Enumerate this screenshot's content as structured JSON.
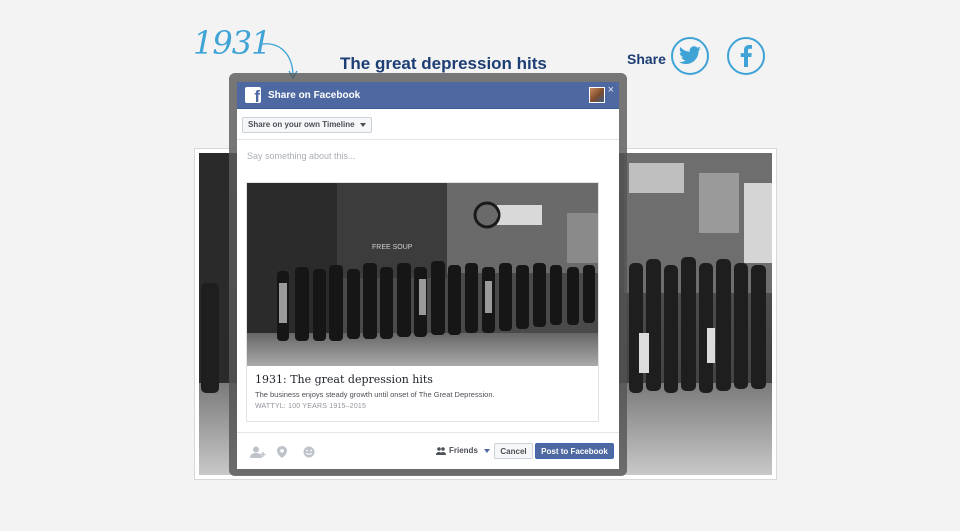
{
  "header": {
    "year": "1931",
    "title": "The great depression hits",
    "share_label": "Share"
  },
  "social": {
    "twitter_icon": "twitter-bird-icon",
    "facebook_icon": "facebook-f-icon",
    "accent_color": "#3fa3d6"
  },
  "dialog": {
    "title": "Share on Facebook",
    "close_label": "×",
    "timeline_select": "Share on your own Timeline",
    "input_placeholder": "Say something about this...",
    "input_value": "",
    "preview": {
      "title": "1931: The great depression hits",
      "description": "The business enjoys steady growth until onset of The Great Depression.",
      "source": "WATTYL: 100 YEARS 1915–2015"
    },
    "footer": {
      "audience": "Friends",
      "cancel_label": "Cancel",
      "post_label": "Post to Facebook"
    },
    "brand_color": "#4e69a2"
  },
  "photo_sign": "FREE SOUP"
}
